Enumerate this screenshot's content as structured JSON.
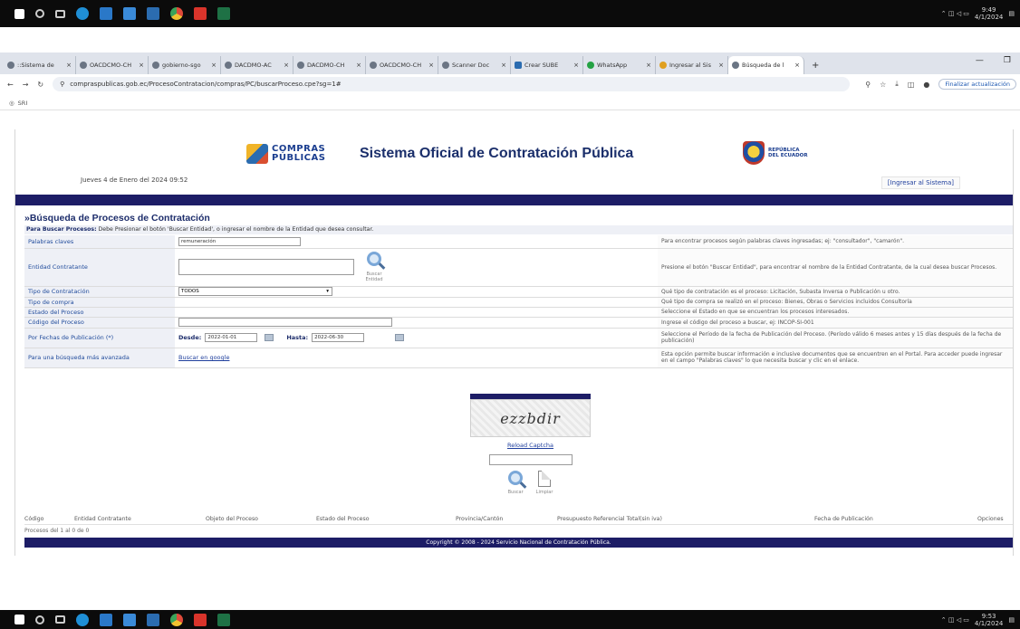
{
  "browser": {
    "tabs": [
      {
        "label": "::Sistema de"
      },
      {
        "label": "OACDCMO-CH"
      },
      {
        "label": "gobierno-sgo"
      },
      {
        "label": "DACDMO-AC"
      },
      {
        "label": "DACDMO-CH"
      },
      {
        "label": "OACDCMO-CH"
      },
      {
        "label": "Scanner Doc"
      },
      {
        "label": "Crear SUBE"
      },
      {
        "label": "WhatsApp"
      },
      {
        "label": "Ingresar al Sis"
      },
      {
        "label": "Búsqueda de l"
      }
    ],
    "url": "compraspublicas.gob.ec/ProcesoContratacion/compras/PC/buscarProceso.cpe?sg=1#",
    "update_label": "Finalizar actualización",
    "bookmark": "SRI"
  },
  "taskbar": {
    "top_time": "9:49",
    "top_date": "4/1/2024",
    "bottom_time": "9:53",
    "bottom_date": "4/1/2024"
  },
  "header": {
    "logo_line1": "COMPRAS",
    "logo_line2": "PÚBLICAS",
    "site_title": "Sistema Oficial de Contratación Pública",
    "rep_line1": "REPÚBLICA",
    "rep_line2": "DEL ECUADOR",
    "date_text": "Jueves 4 de Enero del 2024 09:52",
    "login_label": "[Ingresar al Sistema]"
  },
  "search": {
    "title": "»Búsqueda de Procesos de Contratación",
    "instr_bold": "Para Buscar Procesos:",
    "instr_text": "Debe Presionar el botón 'Buscar Entidad', o ingresar el nombre de la Entidad que desea consultar.",
    "keywords_label": "Palabras claves",
    "keywords_value": "remuneración",
    "keywords_help": "Para encontrar procesos según palabras claves ingresadas; ej: \"consultador\", \"camarón\".",
    "entity_label": "Entidad Contratante",
    "entity_btn": "Buscar Entidad",
    "entity_help": "Presione el botón \"Buscar Entidad\", para encontrar el nombre de la Entidad Contratante, de la cual desea buscar Procesos.",
    "type_label": "Tipo de Contratación",
    "type_value": "TODOS",
    "type_help": "Qué tipo de contratación es el proceso: Licitación, Subasta Inversa o Publicación u otro.",
    "purchase_label": "Tipo de compra",
    "purchase_help": "Qué tipo de compra se realizó en el proceso: Bienes, Obras o Servicios incluidos Consultoría",
    "state_label": "Estado del Proceso",
    "state_help": "Seleccione el Estado en que se encuentran los procesos interesados.",
    "code_label": "Código del Proceso",
    "code_help": "Ingrese el código del proceso a buscar, ej: INCOP-SI-001",
    "dates_label": "Por Fechas de Publicación (*)",
    "from_label": "Desde:",
    "from_value": "2022-01-01",
    "to_label": "Hasta:",
    "to_value": "2022-06-30",
    "dates_help": "Seleccione el Período de la fecha de Publicación del Proceso. (Período válido 6 meses antes y 15 días después de la fecha de publicación)",
    "advanced_label": "Para una búsqueda más avanzada",
    "advanced_link": "Buscar en google",
    "advanced_help": "Esta opción permite buscar información e inclusive documentos que se encuentren en el Portal. Para acceder puede ingresar en el campo \"Palabras claves\" lo que necesita buscar y clic en el enlace."
  },
  "captcha": {
    "text": "ezzbdir",
    "reload": "Reload Captcha",
    "search_btn": "Buscar",
    "clear_btn": "Limpiar"
  },
  "results": {
    "columns": [
      "Código",
      "Entidad Contratante",
      "Objeto del Proceso",
      "Estado del Proceso",
      "Provincia/Cantón",
      "Presupuesto Referencial Total(sin iva)",
      "Fecha de Publicación",
      "Opciones"
    ],
    "count_text": "Procesos del 1 al 0 de 0"
  },
  "footer": "Copyright © 2008 - 2024 Servicio Nacional de Contratación Pública."
}
